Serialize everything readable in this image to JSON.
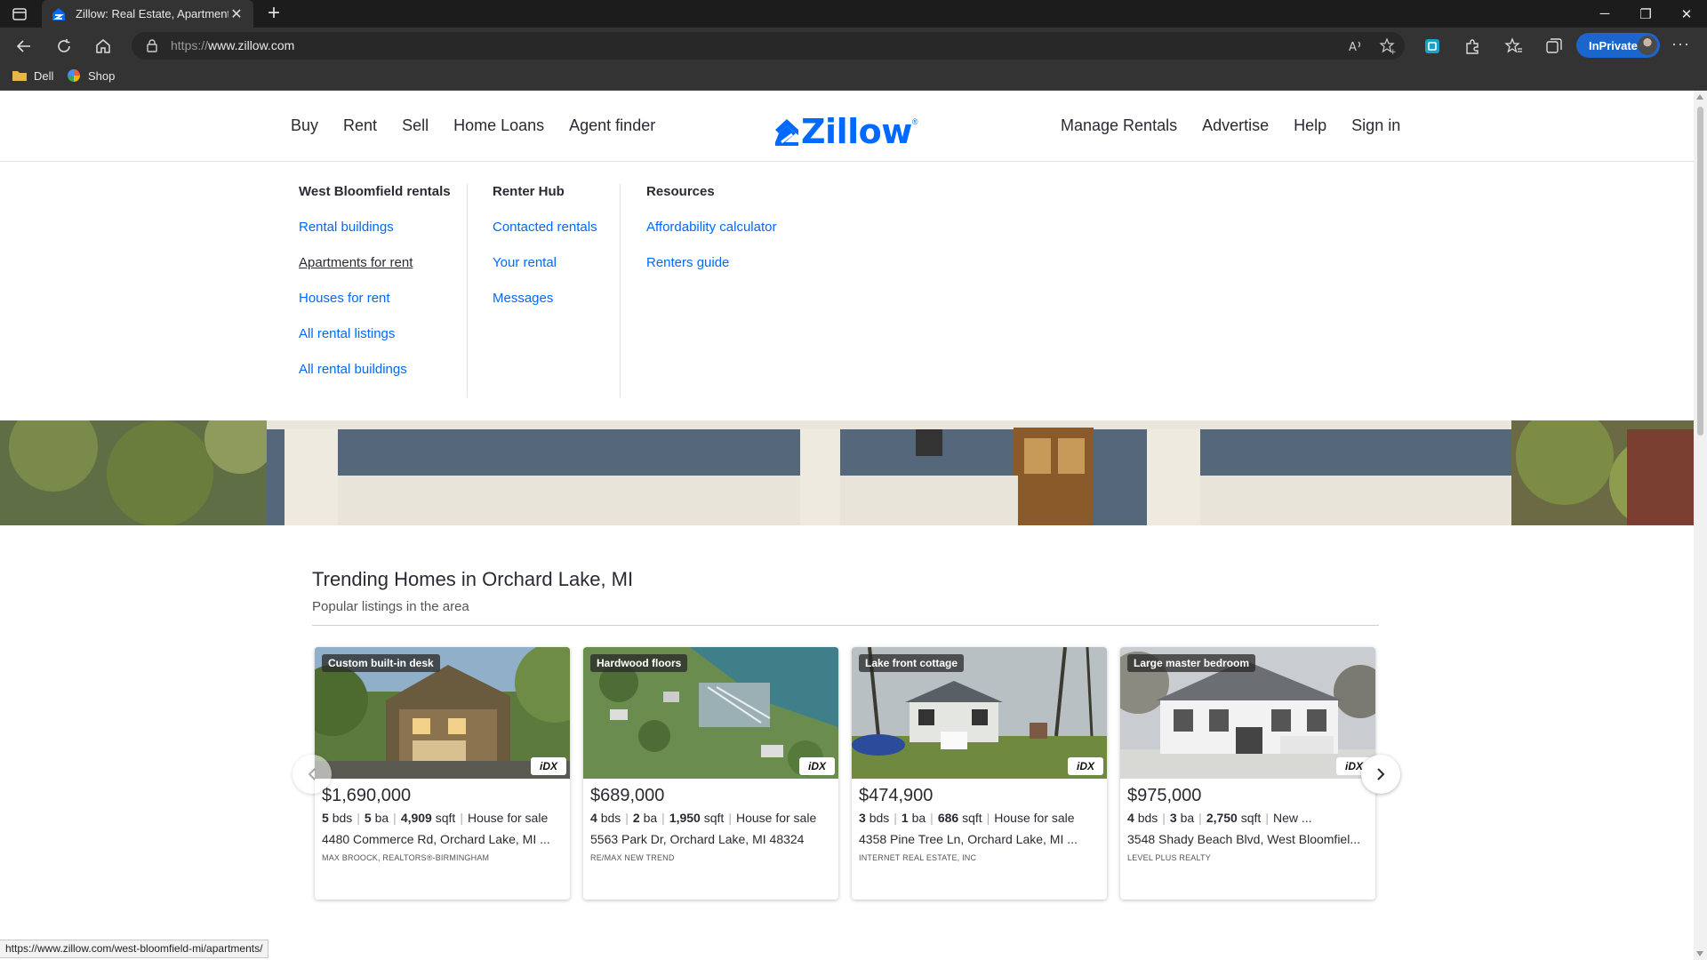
{
  "browser": {
    "tab_title": "Zillow: Real Estate, Apartments, M",
    "url_scheme": "https://",
    "url_host": "www.zillow.com",
    "inprivate_label": "InPrivate",
    "favorites": [
      {
        "label": "Dell",
        "icon": "folder-icon"
      },
      {
        "label": "Shop",
        "icon": "shop-icon"
      }
    ],
    "status_url": "https://www.zillow.com/west-bloomfield-mi/apartments/"
  },
  "header": {
    "left_nav": [
      "Buy",
      "Rent",
      "Sell",
      "Home Loans",
      "Agent finder"
    ],
    "logo_text": "Zillow",
    "logo_reg": "®",
    "right_nav": [
      "Manage Rentals",
      "Advertise",
      "Help",
      "Sign in"
    ]
  },
  "menu": {
    "col1": {
      "title": "West Bloomfield rentals",
      "links": [
        "Rental buildings",
        "Apartments for rent",
        "Houses for rent",
        "All rental listings",
        "All rental buildings"
      ]
    },
    "col2": {
      "title": "Renter Hub",
      "links": [
        "Contacted rentals",
        "Your rental",
        "Messages"
      ]
    },
    "col3": {
      "title": "Resources",
      "links": [
        "Affordability calculator",
        "Renters guide"
      ]
    }
  },
  "trending": {
    "title": "Trending Homes in Orchard Lake, MI",
    "subtitle": "Popular listings in the area",
    "idx_label": "iDX",
    "cards": [
      {
        "badge": "Custom built-in desk",
        "price": "$1,690,000",
        "beds": "5",
        "beds_label": "bds",
        "baths": "5",
        "baths_label": "ba",
        "sqft": "4,909",
        "sqft_label": "sqft",
        "status": "House for sale",
        "address": "4480 Commerce Rd, Orchard Lake, MI ...",
        "broker": "MAX BROOCK, REALTORS®-BIRMINGHAM"
      },
      {
        "badge": "Hardwood floors",
        "price": "$689,000",
        "beds": "4",
        "beds_label": "bds",
        "baths": "2",
        "baths_label": "ba",
        "sqft": "1,950",
        "sqft_label": "sqft",
        "status": "House for sale",
        "address": "5563 Park Dr, Orchard Lake, MI 48324",
        "broker": "RE/MAX NEW TREND"
      },
      {
        "badge": "Lake front cottage",
        "price": "$474,900",
        "beds": "3",
        "beds_label": "bds",
        "baths": "1",
        "baths_label": "ba",
        "sqft": "686",
        "sqft_label": "sqft",
        "status": "House for sale",
        "address": "4358 Pine Tree Ln, Orchard Lake, MI ...",
        "broker": "INTERNET REAL ESTATE, INC"
      },
      {
        "badge": "Large master bedroom",
        "price": "$975,000",
        "beds": "4",
        "beds_label": "bds",
        "baths": "3",
        "baths_label": "ba",
        "sqft": "2,750",
        "sqft_label": "sqft",
        "status": "New ...",
        "address": "3548 Shady Beach Blvd, West Bloomfiel...",
        "broker": "LEVEL PLUS REALTY"
      }
    ]
  },
  "colors": {
    "zillow_blue": "#006aff",
    "text_dark": "#2a2a33",
    "browser_dark": "#333333",
    "inprivate_blue": "#1a66cc"
  }
}
